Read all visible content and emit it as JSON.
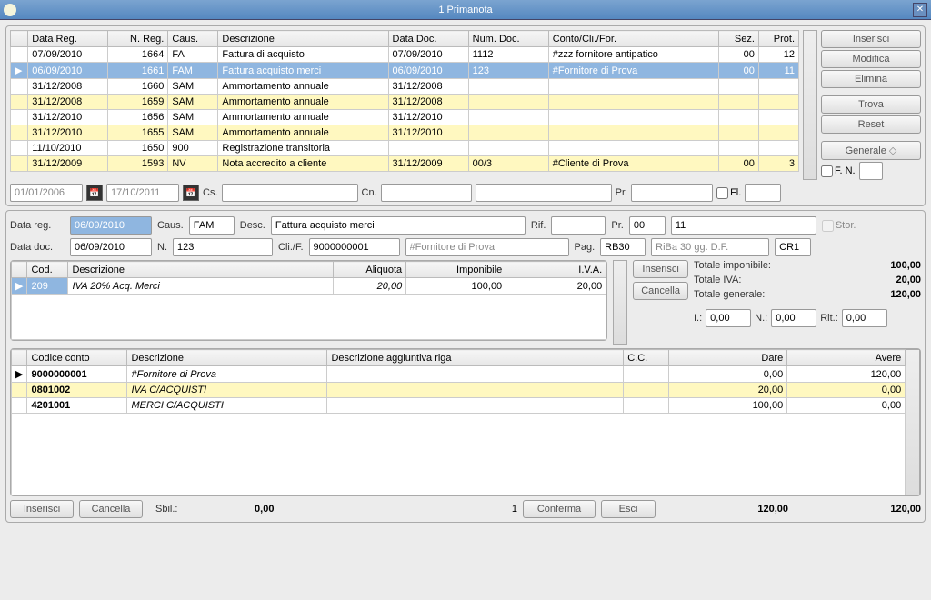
{
  "window": {
    "title": "1 Primanota"
  },
  "columns": [
    "Data Reg.",
    "N. Reg.",
    "Caus.",
    "Descrizione",
    "Data Doc.",
    "Num. Doc.",
    "Conto/Cli./For.",
    "Sez.",
    "Prot."
  ],
  "rows": [
    {
      "sel": false,
      "yellow": false,
      "datareg": "07/09/2010",
      "nreg": "1664",
      "caus": "FA",
      "desc": "Fattura di acquisto",
      "datadoc": "07/09/2010",
      "numdoc": "1112",
      "conto": "#zzz fornitore antipatico",
      "sez": "00",
      "prot": "12"
    },
    {
      "sel": true,
      "yellow": false,
      "datareg": "06/09/2010",
      "nreg": "1661",
      "caus": "FAM",
      "desc": "Fattura acquisto merci",
      "datadoc": "06/09/2010",
      "numdoc": "123",
      "conto": "#Fornitore di Prova",
      "sez": "00",
      "prot": "11"
    },
    {
      "sel": false,
      "yellow": false,
      "datareg": "31/12/2008",
      "nreg": "1660",
      "caus": "SAM",
      "desc": "Ammortamento annuale",
      "datadoc": "31/12/2008",
      "numdoc": "",
      "conto": "",
      "sez": "",
      "prot": ""
    },
    {
      "sel": false,
      "yellow": true,
      "datareg": "31/12/2008",
      "nreg": "1659",
      "caus": "SAM",
      "desc": "Ammortamento annuale",
      "datadoc": "31/12/2008",
      "numdoc": "",
      "conto": "",
      "sez": "",
      "prot": ""
    },
    {
      "sel": false,
      "yellow": false,
      "datareg": "31/12/2010",
      "nreg": "1656",
      "caus": "SAM",
      "desc": "Ammortamento annuale",
      "datadoc": "31/12/2010",
      "numdoc": "",
      "conto": "",
      "sez": "",
      "prot": ""
    },
    {
      "sel": false,
      "yellow": true,
      "datareg": "31/12/2010",
      "nreg": "1655",
      "caus": "SAM",
      "desc": "Ammortamento annuale",
      "datadoc": "31/12/2010",
      "numdoc": "",
      "conto": "",
      "sez": "",
      "prot": ""
    },
    {
      "sel": false,
      "yellow": false,
      "datareg": "11/10/2010",
      "nreg": "1650",
      "caus": "900",
      "desc": "Registrazione transitoria",
      "datadoc": "",
      "numdoc": "",
      "conto": "",
      "sez": "",
      "prot": ""
    },
    {
      "sel": false,
      "yellow": true,
      "datareg": "31/12/2009",
      "nreg": "1593",
      "caus": "NV",
      "desc": "Nota accredito a cliente",
      "datadoc": "31/12/2009",
      "numdoc": "00/3",
      "conto": "#Cliente di Prova",
      "sez": "00",
      "prot": "3"
    }
  ],
  "actions": {
    "inserisci": "Inserisci",
    "modifica": "Modifica",
    "elimina": "Elimina",
    "trova": "Trova",
    "reset": "Reset",
    "generale": "Generale",
    "fn": "F. N.",
    "fl": "Fl."
  },
  "filter": {
    "from": "01/01/2006",
    "to": "17/10/2011",
    "cs": "Cs.",
    "cn": "Cn.",
    "pr": "Pr."
  },
  "form": {
    "datareg_lbl": "Data reg.",
    "datareg": "06/09/2010",
    "caus_lbl": "Caus.",
    "caus": "FAM",
    "desc_lbl": "Desc.",
    "desc": "Fattura acquisto merci",
    "rif_lbl": "Rif.",
    "rif": "",
    "pr_lbl": "Pr.",
    "pr": "00",
    "prot": "11",
    "stor_lbl": "Stor.",
    "datadoc_lbl": "Data doc.",
    "datadoc": "06/09/2010",
    "n_lbl": "N.",
    "n": "123",
    "clif_lbl": "Cli./F.",
    "clif": "9000000001",
    "clif_desc": "#Fornitore di Prova",
    "pag_lbl": "Pag.",
    "pag": "RB30",
    "pag_desc": "RiBa 30 gg. D.F.",
    "cr": "CR1"
  },
  "iva": {
    "cols": [
      "Cod.",
      "Descrizione",
      "Aliquota",
      "Imponibile",
      "I.V.A."
    ],
    "rows": [
      {
        "cod": "209",
        "desc": "IVA 20% Acq. Merci",
        "aliq": "20,00",
        "imp": "100,00",
        "iva": "20,00"
      }
    ],
    "inserisci": "Inserisci",
    "cancella": "Cancella"
  },
  "totals": {
    "imp_lbl": "Totale imponibile:",
    "imp": "100,00",
    "iva_lbl": "Totale IVA:",
    "iva": "20,00",
    "gen_lbl": "Totale generale:",
    "gen": "120,00",
    "i_lbl": "I.:",
    "i": "0,00",
    "n_lbl": "N.:",
    "n": "0,00",
    "rit_lbl": "Rit.:",
    "rit": "0,00"
  },
  "conto": {
    "cols": [
      "Codice conto",
      "Descrizione",
      "Descrizione aggiuntiva riga",
      "C.C.",
      "Dare",
      "Avere"
    ],
    "rows": [
      {
        "sel": true,
        "cod": "9000000001",
        "desc": "#Fornitore di Prova",
        "agg": "",
        "cc": "",
        "dare": "0,00",
        "avere": "120,00"
      },
      {
        "yellow": true,
        "cod": "0801002",
        "desc": "IVA C/ACQUISTI",
        "agg": "",
        "cc": "",
        "dare": "20,00",
        "avere": "0,00"
      },
      {
        "cod": "4201001",
        "desc": "MERCI C/ACQUISTI",
        "agg": "",
        "cc": "",
        "dare": "100,00",
        "avere": "0,00"
      }
    ]
  },
  "bottom": {
    "inserisci": "Inserisci",
    "cancella": "Cancella",
    "sbil_lbl": "Sbil.:",
    "sbil": "0,00",
    "count": "1",
    "conferma": "Conferma",
    "esci": "Esci",
    "dare": "120,00",
    "avere": "120,00"
  }
}
